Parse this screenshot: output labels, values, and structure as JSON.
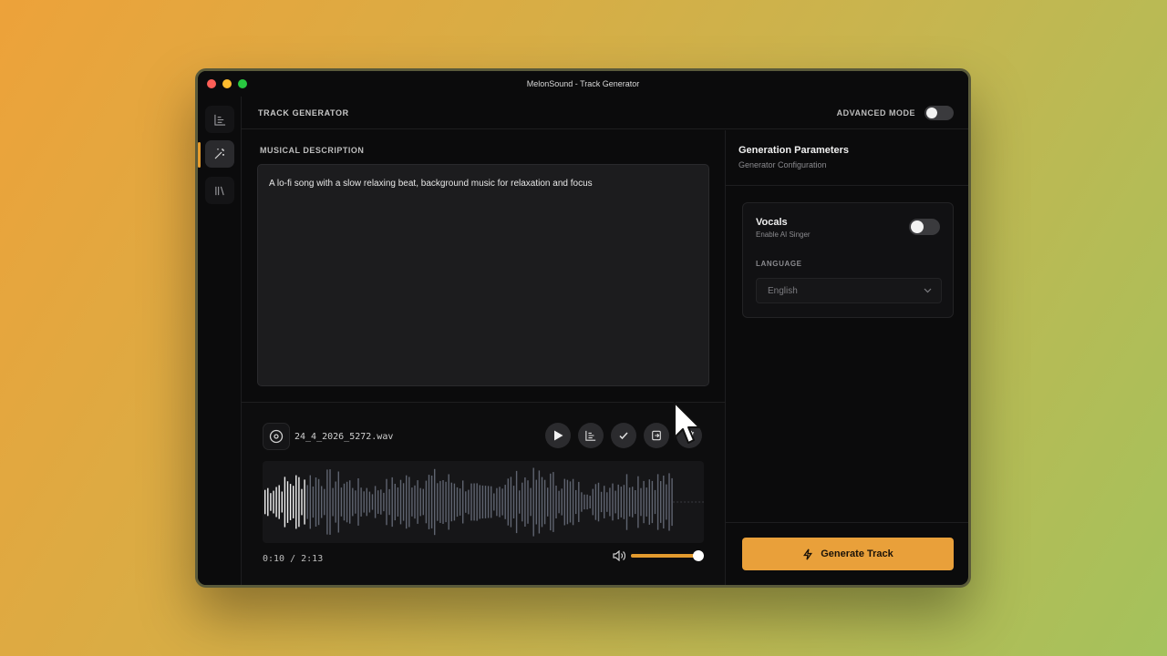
{
  "window": {
    "title": "MelonSound - Track Generator"
  },
  "sidebar": {
    "items": [
      {
        "name": "stats",
        "icon": "bar-chart-icon",
        "active": false
      },
      {
        "name": "generator",
        "icon": "magic-wand-icon",
        "active": true
      },
      {
        "name": "library",
        "icon": "library-icon",
        "active": false
      }
    ]
  },
  "header": {
    "title": "TRACK GENERATOR",
    "advanced_label": "ADVANCED MODE",
    "advanced_on": false
  },
  "description": {
    "label": "MUSICAL DESCRIPTION",
    "value": "A lo-fi song with a slow relaxing beat, background music for relaxation and focus"
  },
  "player": {
    "filename": "24_4_2026_5272.wav",
    "time": "0:10 / 2:13",
    "progress": 0.075,
    "volume": 1.0,
    "controls": [
      "play-icon",
      "stats-icon",
      "check-icon",
      "export-icon",
      "delete-icon"
    ]
  },
  "params": {
    "title": "Generation Parameters",
    "subtitle": "Generator Configuration",
    "vocals_title": "Vocals",
    "vocals_sub": "Enable AI Singer",
    "vocals_on": false,
    "language_label": "LANGUAGE",
    "language_value": "English"
  },
  "generate": {
    "label": "Generate Track"
  },
  "colors": {
    "accent": "#e9a03a",
    "bg": "#0b0b0c",
    "panel": "#1c1c1e"
  }
}
